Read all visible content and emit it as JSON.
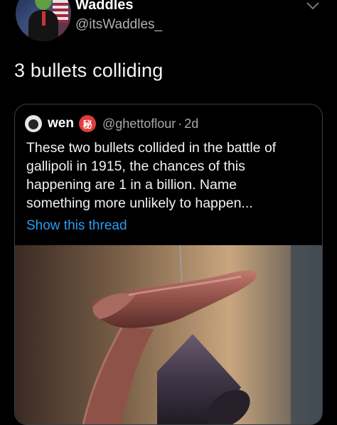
{
  "author": {
    "display_name": "Waddles",
    "handle": "@itsWaddles_"
  },
  "tweet_text": "3 bullets colliding",
  "quoted_tweet": {
    "display_name": "wen",
    "badge_text": "秘",
    "handle": "@ghettoflour",
    "separator": "·",
    "time": "2d",
    "text_lines": [
      "These two bullets collided in the battle of",
      "gallipoli in 1915, the chances of this",
      "happening are 1 in a billion. Name",
      "something more unlikely to happen..."
    ],
    "link_text": "Show this thread"
  },
  "icons": {
    "menu": "chevron-down-icon",
    "quoted_avatar": "avatar-icon"
  },
  "colors": {
    "background": "#000000",
    "link": "#2b9bf0",
    "secondary_text": "#a8a8a8",
    "badge": "#e23a3a"
  }
}
